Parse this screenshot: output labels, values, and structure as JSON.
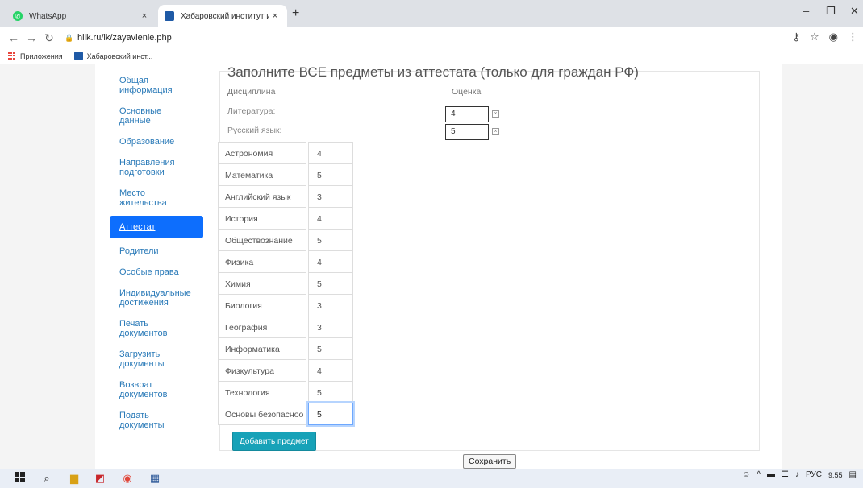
{
  "browser": {
    "tabs": [
      {
        "title": "WhatsApp",
        "close": "×"
      },
      {
        "title": "Хабаровский институт инфоком",
        "close": "×"
      }
    ],
    "new_tab": "+",
    "url": "hiik.ru/lk/zayavlenie.php",
    "bookmarks": [
      "Приложения",
      "Хабаровский инст..."
    ]
  },
  "sidebar": {
    "items": [
      {
        "label": "Общая информация",
        "active": false
      },
      {
        "label": "Основные данные",
        "active": false
      },
      {
        "label": "Образование",
        "active": false
      },
      {
        "label": "Направления подготовки",
        "active": false
      },
      {
        "label": "Место жительства",
        "active": false
      },
      {
        "label": "Аттестат",
        "active": true
      },
      {
        "label": "Родители",
        "active": false
      },
      {
        "label": "Особые права",
        "active": false
      },
      {
        "label": "Индивидуальные достижения",
        "active": false
      },
      {
        "label": "Печать документов",
        "active": false
      },
      {
        "label": "Загрузить документы",
        "active": false
      },
      {
        "label": "Возврат документов",
        "active": false
      },
      {
        "label": "Подать документы",
        "active": false
      }
    ]
  },
  "form": {
    "title": "Заполните ВСЕ предметы из аттестата (только для граждан РФ)",
    "header_discipline": "Дисциплина",
    "header_grade": "Оценка",
    "fixed_subjects": [
      {
        "name": "Литература:",
        "grade": "4"
      },
      {
        "name": "Русский язык:",
        "grade": "5"
      }
    ],
    "subjects": [
      {
        "name": "Астрономия",
        "grade": "4"
      },
      {
        "name": "Математика",
        "grade": "5"
      },
      {
        "name": "Английский язык",
        "grade": "3"
      },
      {
        "name": "История",
        "grade": "4"
      },
      {
        "name": "Обществознание",
        "grade": "5"
      },
      {
        "name": "Физика",
        "grade": "4"
      },
      {
        "name": "Химия",
        "grade": "5"
      },
      {
        "name": "Биология",
        "grade": "3"
      },
      {
        "name": "География",
        "grade": "3"
      },
      {
        "name": "Информатика",
        "grade": "5"
      },
      {
        "name": "Физкультура",
        "grade": "4"
      },
      {
        "name": "Технология",
        "grade": "5"
      },
      {
        "name": "Основы безопасноо",
        "grade": "5"
      }
    ],
    "add_button": "Добавить предмет",
    "save_button": "Сохранить"
  },
  "taskbar": {
    "lang": "РУС",
    "time": "9:55"
  },
  "colors": {
    "link": "#2a7ab8",
    "active_nav": "#0d6efd",
    "add_button": "#17a2b8"
  }
}
